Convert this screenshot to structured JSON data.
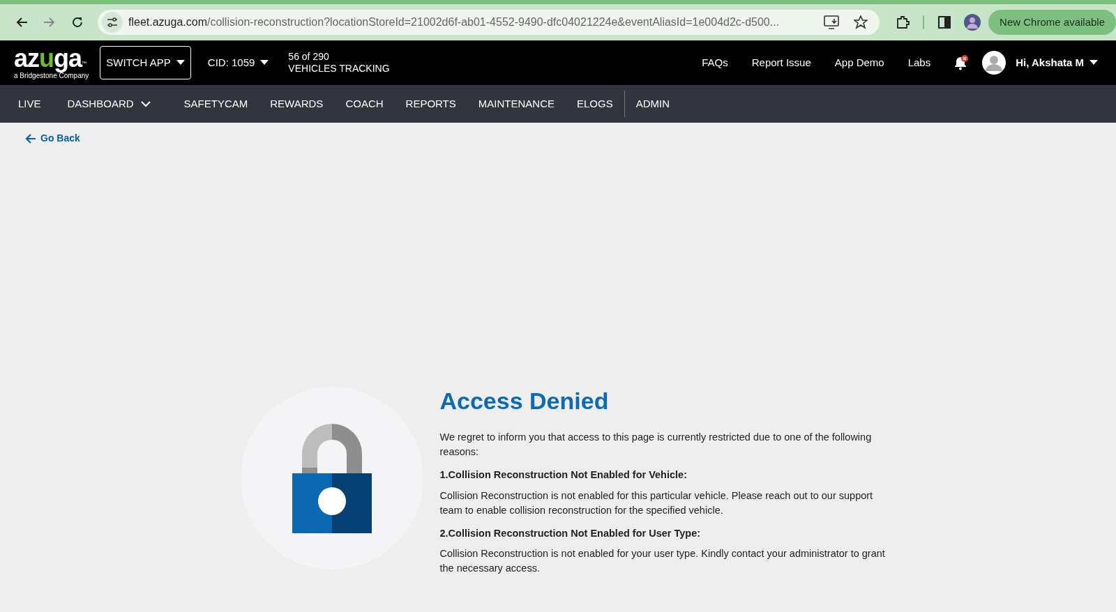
{
  "browser": {
    "url_domain": "fleet.azuga.com",
    "url_path": "/collision-reconstruction?locationStoreId=21002d6f-ab01-4552-9490-dfc04021224e&eventAliasId=1e004d2c-d500...",
    "update_button": "New Chrome available"
  },
  "header": {
    "logo": {
      "parts": [
        "az",
        "u",
        "ga"
      ],
      "trademark": "™",
      "tagline": "a Bridgestone Company"
    },
    "switch_app": "SWITCH APP",
    "cid": "CID: 1059",
    "tracking_count": "56 of 290",
    "tracking_label": "VEHICLES TRACKING",
    "links": [
      "FAQs",
      "Report Issue",
      "App Demo",
      "Labs"
    ],
    "notifications_alert": true,
    "user": "Hi, Akshata M"
  },
  "nav": {
    "items": [
      {
        "label": "LIVE",
        "kind": "link",
        "separated": false
      },
      {
        "label": "DASHBOARD",
        "kind": "dropdown",
        "separated": false
      },
      {
        "label": "SAFETYCAM",
        "kind": "link",
        "separated": false
      },
      {
        "label": "REWARDS",
        "kind": "link",
        "separated": false
      },
      {
        "label": "COACH",
        "kind": "link",
        "separated": false
      },
      {
        "label": "REPORTS",
        "kind": "link",
        "separated": false
      },
      {
        "label": "MAINTENANCE",
        "kind": "link",
        "separated": false
      },
      {
        "label": "ELOGS",
        "kind": "link",
        "separated": false
      },
      {
        "label": "ADMIN",
        "kind": "link",
        "separated": true
      }
    ]
  },
  "back_link": "Go Back",
  "message": {
    "title": "Access Denied",
    "intro": "We regret to inform you that access to this page is currently restricted due to one of the following reasons:",
    "reasons": [
      {
        "heading": "1.Collision Reconstruction Not Enabled for Vehicle:",
        "text": "Collision Reconstruction is not enabled for this particular vehicle. Please reach out to our support team to enable collision reconstruction for the specified vehicle."
      },
      {
        "heading": "2.Collision Reconstruction Not Enabled for User Type:",
        "text": "Collision Reconstruction is not enabled for your user type. Kindly contact your administrator to grant the necessary access."
      }
    ]
  }
}
